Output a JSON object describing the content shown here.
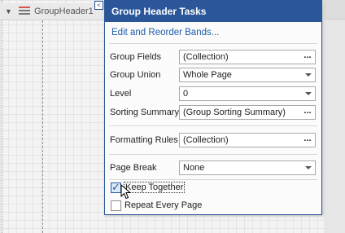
{
  "designer": {
    "band_label": "GroupHeader1"
  },
  "panel": {
    "title": "Group Header Tasks",
    "link": "Edit and Reorder Bands...",
    "group_fields": {
      "label": "Group Fields",
      "value": "(Collection)",
      "button": "..."
    },
    "group_union": {
      "label": "Group Union",
      "value": "Whole Page"
    },
    "level": {
      "label": "Level",
      "value": "0"
    },
    "sorting_summary": {
      "label": "Sorting Summary",
      "value": "(Group Sorting Summary)",
      "button": "..."
    },
    "formatting_rules": {
      "label": "Formatting Rules",
      "value": "(Collection)",
      "button": "..."
    },
    "page_break": {
      "label": "Page Break",
      "value": "None"
    },
    "keep_together": {
      "label": "Keep Together",
      "checked": true
    },
    "repeat_every_page": {
      "label": "Repeat Every Page",
      "checked": false
    }
  },
  "colors": {
    "accent": "#2b579a",
    "link": "#1c5dad"
  }
}
